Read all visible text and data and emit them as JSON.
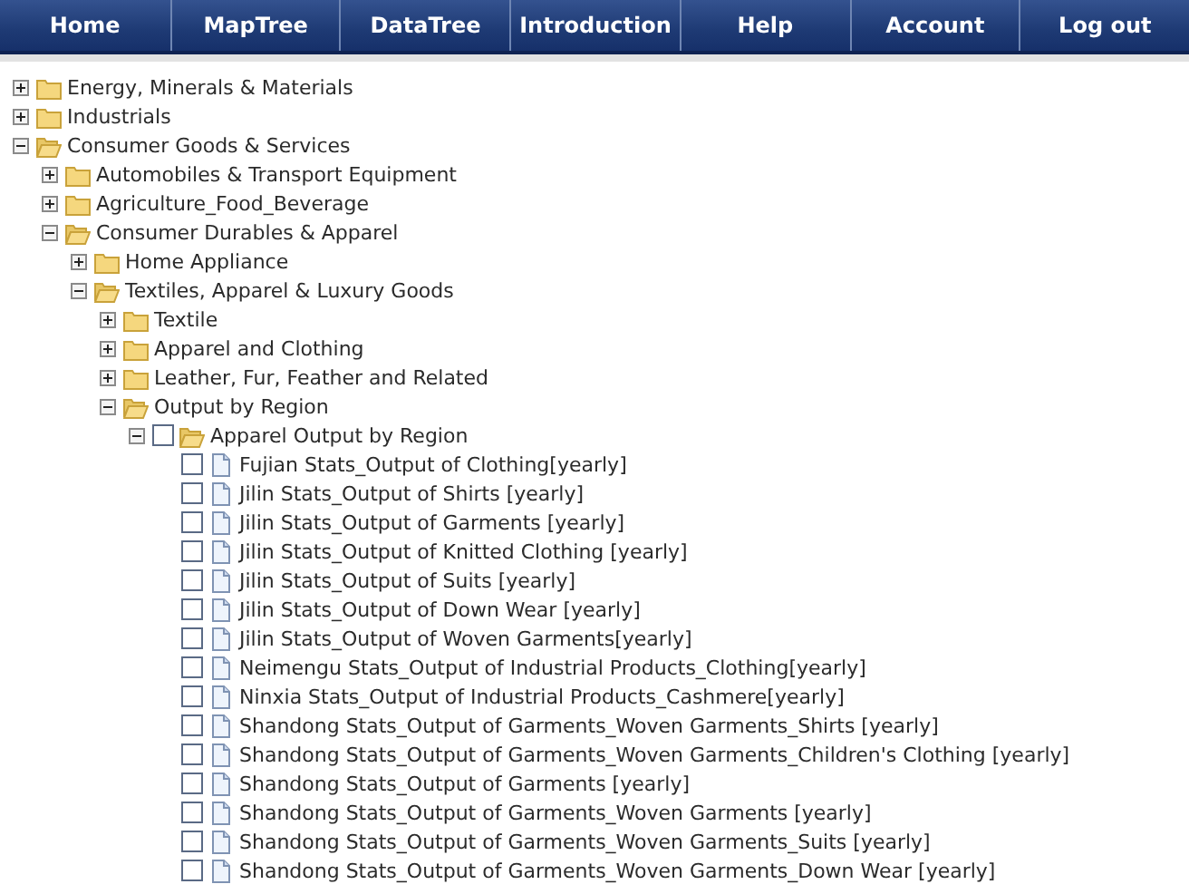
{
  "nav": [
    {
      "label": "Home"
    },
    {
      "label": "MapTree"
    },
    {
      "label": "DataTree"
    },
    {
      "label": "Introduction"
    },
    {
      "label": "Help"
    },
    {
      "label": "Account"
    },
    {
      "label": "Log out"
    }
  ],
  "tree": [
    {
      "kind": "folder",
      "label": "Energy, Minerals & Materials",
      "expanded": false
    },
    {
      "kind": "folder",
      "label": "Industrials",
      "expanded": false
    },
    {
      "kind": "folder",
      "label": "Consumer Goods & Services",
      "expanded": true,
      "children": [
        {
          "kind": "folder",
          "label": "Automobiles & Transport Equipment",
          "expanded": false
        },
        {
          "kind": "folder",
          "label": "Agriculture_Food_Beverage",
          "expanded": false
        },
        {
          "kind": "folder",
          "label": "Consumer Durables & Apparel",
          "expanded": true,
          "children": [
            {
              "kind": "folder",
              "label": "Home Appliance",
              "expanded": false
            },
            {
              "kind": "folder",
              "label": "Textiles, Apparel & Luxury Goods",
              "expanded": true,
              "children": [
                {
                  "kind": "folder",
                  "label": "Textile",
                  "expanded": false
                },
                {
                  "kind": "folder",
                  "label": "Apparel and Clothing",
                  "expanded": false
                },
                {
                  "kind": "folder",
                  "label": "Leather, Fur, Feather and Related",
                  "expanded": false
                },
                {
                  "kind": "folder",
                  "label": "Output by Region",
                  "expanded": true,
                  "children": [
                    {
                      "kind": "folder",
                      "label": "Apparel Output by Region",
                      "expanded": true,
                      "checked": false,
                      "children": [
                        {
                          "kind": "file",
                          "label": "Fujian Stats_Output of Clothing[yearly]",
                          "checked": false
                        },
                        {
                          "kind": "file",
                          "label": "Jilin Stats_Output of Shirts [yearly]",
                          "checked": false
                        },
                        {
                          "kind": "file",
                          "label": "Jilin Stats_Output of Garments [yearly]",
                          "checked": false
                        },
                        {
                          "kind": "file",
                          "label": "Jilin Stats_Output of Knitted Clothing [yearly]",
                          "checked": false
                        },
                        {
                          "kind": "file",
                          "label": "Jilin Stats_Output of Suits [yearly]",
                          "checked": false
                        },
                        {
                          "kind": "file",
                          "label": "Jilin Stats_Output of Down Wear [yearly]",
                          "checked": false
                        },
                        {
                          "kind": "file",
                          "label": "Jilin Stats_Output of Woven Garments[yearly]",
                          "checked": false
                        },
                        {
                          "kind": "file",
                          "label": "Neimengu Stats_Output of Industrial Products_Clothing[yearly]",
                          "checked": false
                        },
                        {
                          "kind": "file",
                          "label": "Ninxia Stats_Output of Industrial Products_Cashmere[yearly]",
                          "checked": false
                        },
                        {
                          "kind": "file",
                          "label": "Shandong Stats_Output of Garments_Woven Garments_Shirts [yearly]",
                          "checked": false
                        },
                        {
                          "kind": "file",
                          "label": "Shandong Stats_Output of Garments_Woven Garments_Children's Clothing [yearly]",
                          "checked": false
                        },
                        {
                          "kind": "file",
                          "label": "Shandong Stats_Output of Garments [yearly]",
                          "checked": false
                        },
                        {
                          "kind": "file",
                          "label": "Shandong Stats_Output of Garments_Woven Garments [yearly]",
                          "checked": false
                        },
                        {
                          "kind": "file",
                          "label": "Shandong Stats_Output of Garments_Woven Garments_Suits [yearly]",
                          "checked": false
                        },
                        {
                          "kind": "file",
                          "label": "Shandong Stats_Output of Garments_Woven Garments_Down Wear [yearly]",
                          "checked": false
                        }
                      ]
                    }
                  ]
                }
              ]
            }
          ]
        }
      ]
    }
  ]
}
